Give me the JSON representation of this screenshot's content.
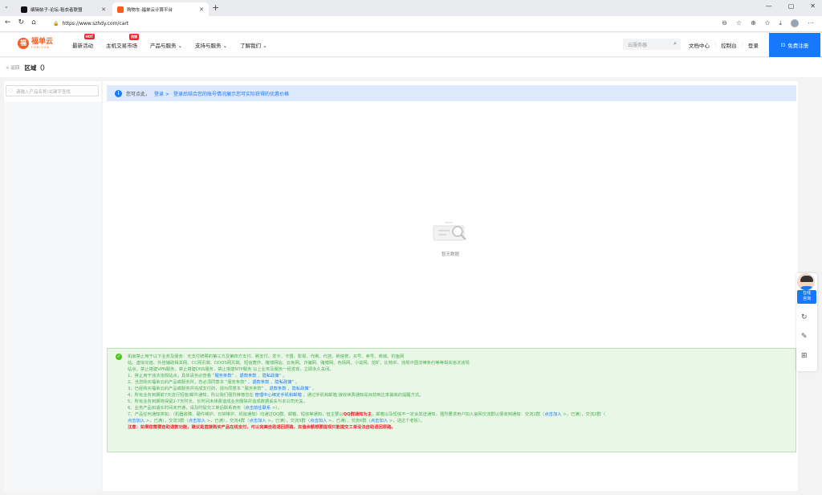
{
  "browser": {
    "tabs": [
      {
        "title": "编辑帖子-论坛-租衣者联盟",
        "favicon_color": "#111111"
      },
      {
        "title": "购物车-福单云计算平台",
        "favicon_color": "#ff5a1f"
      }
    ],
    "url": "https://www.szhdy.com/cart"
  },
  "site": {
    "logo_name": "福单云",
    "logo_sub": "FUDIYUN",
    "nav": [
      {
        "label": "最新活动",
        "badge": "HOT"
      },
      {
        "label": "主机交易市场",
        "badge": "热销"
      },
      {
        "label": "产品与服务 ⌄",
        "badge": ""
      },
      {
        "label": "支持与服务 ⌄",
        "badge": ""
      },
      {
        "label": "了解我们 ⌄",
        "badge": ""
      }
    ],
    "search_placeholder": "云服务器",
    "links": [
      "文档中心",
      "控制台",
      "登录"
    ],
    "register_label": "免费注册"
  },
  "breadcrumb": {
    "back_label": "< 返回",
    "title": "区域（）"
  },
  "sidebar": {
    "search_placeholder": "请输入产品名称/关键字查找"
  },
  "login_bar": {
    "prefix": "您可点此，",
    "link": "登录 >",
    "desc": "登录后结合您的账号情况展示您可实际获得的优惠价格"
  },
  "empty": {
    "text": "暂无数据"
  },
  "notice": {
    "line1": "机房禁止用于以下业务及服务：无支付牌照的第三方及第四方支付、刷支付、发卡、卡盟、影视、代刷、代挂、刷信誉、买号、卖号、商城、钓鱼网",
    "line2": "站、虚拟充值、外挂辅助相关网、CC网页端、DDOS网页端、短信轰炸、赌博网站、云免网、诈骗网、赌博网、色情网、小说网、挖矿、比特币、违规中国法律条约等等相关违法违规",
    "line3": "站点。禁止搭建VPN服务，禁止搭建DNS服务，禁止搭建NTP服务 以上业务及服务一经发现，立即永久关闭。",
    "line4a": "1、禁止用于违法违规站点。具体请务必查看 “",
    "line4b": "服务条款",
    "line4c": "” 、",
    "line4d": "退款条款",
    "line4e": " 、",
    "line4f": "隐私政策",
    "line4g": "” 。",
    "line5a": "2、当您购买福单云的产品或服务时，您必须同意本 “服务条款",
    "line5b": "” 、退款条款",
    "line5c": " 、隐私政策",
    "line5d": "” 。",
    "line6a": "3、已经购买福单云的产品或服务并完成支付的，视为同意本 “服务条款",
    "line6b": "” 、退款条款",
    "line6c": " 、隐私政策",
    "line6d": "” 。",
    "line7a": "4、所有业务到期前7天进行短信/邮件通知，所以我们强烈推荐您在 ",
    "line7b": "管理中心绑定手机和邮箱",
    "line7c": " ，通过手机和邮箱",
    "line7d": " 接收续费通知是目前到达率最高的提醒方式。",
    "line8": "5、所有业务到期将保留2-7天时长，长时间未续费造成业务删除并造成数据丢失与本公司无关。",
    "line9a": "6、业务产品如遇长时间未开通，请及时提交工单后联系商务（",
    "line9b": "点击前往联系",
    "line9c": " >）。",
    "line10a": "7、产品任何通知类如：（机器故障、硬件维护、日常维护、机房通知）均通过QQ群、邮箱、短信等通知，但主要以",
    "line10b": "QQ群通知为主",
    "line10c": "，邮箱以及短信不一定会发送通知，强烈要求用户加入官网交流群以便收到通知：交流1群（",
    "line10d": "点击加入",
    "line10e": " >，已满），交流2群（",
    "line11a": "点击加入",
    "line11b": " >，已满），交流3群（",
    "line11c": "点击加入",
    "line11d": " >，已满），交流4群（",
    "line11e": "点击加入",
    "line11f": " >，已满），交流5群（",
    "line11g": "点击加入",
    "line11h": " >，已满），交流6群（",
    "line11i": "点击加入",
    "line11j": " >，进这个老板）。",
    "line12": "注意：如果您需要自助退款功能，建议是直接购买产品在线支付，可以完美自助退回原路，充值余额想要提现只能提交工单没法自助退回原路。"
  },
  "float": {
    "cs_label_1": "在线",
    "cs_label_2": "咨询"
  },
  "colors": {
    "primary": "#1677ff",
    "brand": "#ff5a1f",
    "notice_bg": "#e8f7e6",
    "notice_text": "#4caf50"
  }
}
